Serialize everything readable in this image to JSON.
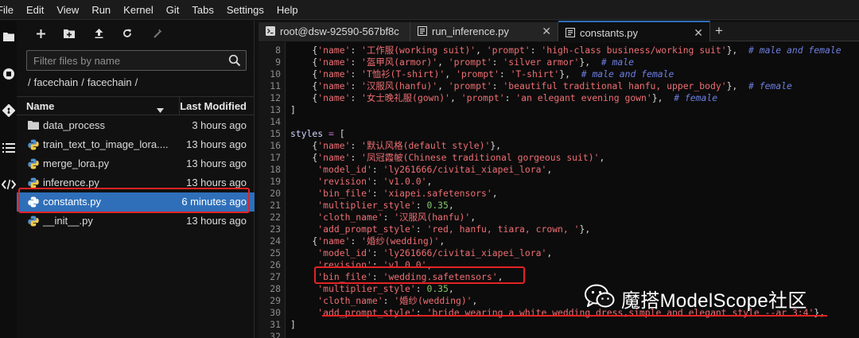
{
  "menu": [
    "File",
    "Edit",
    "View",
    "Run",
    "Kernel",
    "Git",
    "Tabs",
    "Settings",
    "Help"
  ],
  "activity_icons": [
    "folder-icon",
    "running-icon",
    "git-icon",
    "toc-icon",
    "extension-icon"
  ],
  "file_browser": {
    "toolbar_icons": [
      "new-launcher-icon",
      "new-folder-icon",
      "upload-icon",
      "refresh-icon",
      "git-clone-icon"
    ],
    "filter_placeholder": "Filter files by name",
    "breadcrumb": [
      "/",
      "facechain",
      "/",
      "facechain",
      "/"
    ],
    "header_name": "Name",
    "header_modified": "Last Modified",
    "files": [
      {
        "name": "data_process",
        "modified": "3 hours ago",
        "icon": "folder-icon"
      },
      {
        "name": "train_text_to_image_lora....",
        "modified": "13 hours ago",
        "icon": "python-icon"
      },
      {
        "name": "merge_lora.py",
        "modified": "13 hours ago",
        "icon": "python-icon"
      },
      {
        "name": "inference.py",
        "modified": "13 hours ago",
        "icon": "python-icon"
      },
      {
        "name": "constants.py",
        "modified": "6 minutes ago",
        "icon": "python-icon",
        "selected": true
      },
      {
        "name": "__init__.py",
        "modified": "13 hours ago",
        "icon": "python-icon"
      }
    ]
  },
  "tabs": [
    {
      "label": "root@dsw-92590-567bf8c",
      "icon": "terminal-icon"
    },
    {
      "label": "run_inference.py",
      "icon": "file-icon"
    },
    {
      "label": "constants.py",
      "icon": "file-icon",
      "active": true
    }
  ],
  "code_lines": [
    {
      "n": "8",
      "t": [
        [
          "",
          "    {"
        ],
        [
          "s",
          "'name'"
        ],
        [
          "",
          ": "
        ],
        [
          "s",
          "'工作服(working suit)'"
        ],
        [
          "",
          ", "
        ],
        [
          "s",
          "'prompt'"
        ],
        [
          "",
          ": "
        ],
        [
          "s",
          "'high-class business/working suit'"
        ],
        [
          "",
          "},  "
        ],
        [
          "c",
          "# male and female"
        ]
      ]
    },
    {
      "n": "9",
      "t": [
        [
          "",
          "    {"
        ],
        [
          "s",
          "'name'"
        ],
        [
          "",
          ": "
        ],
        [
          "s",
          "'盔甲风(armor)'"
        ],
        [
          "",
          ", "
        ],
        [
          "s",
          "'prompt'"
        ],
        [
          "",
          ": "
        ],
        [
          "s",
          "'silver armor'"
        ],
        [
          "",
          "},  "
        ],
        [
          "c",
          "# male"
        ]
      ]
    },
    {
      "n": "10",
      "t": [
        [
          "",
          "    {"
        ],
        [
          "s",
          "'name'"
        ],
        [
          "",
          ": "
        ],
        [
          "s",
          "'T恤衫(T-shirt)'"
        ],
        [
          "",
          ", "
        ],
        [
          "s",
          "'prompt'"
        ],
        [
          "",
          ": "
        ],
        [
          "s",
          "'T-shirt'"
        ],
        [
          "",
          "},  "
        ],
        [
          "c",
          "# male and female"
        ]
      ]
    },
    {
      "n": "11",
      "t": [
        [
          "",
          "    {"
        ],
        [
          "s",
          "'name'"
        ],
        [
          "",
          ": "
        ],
        [
          "s",
          "'汉服风(hanfu)'"
        ],
        [
          "",
          ", "
        ],
        [
          "s",
          "'prompt'"
        ],
        [
          "",
          ": "
        ],
        [
          "s",
          "'beautiful traditional hanfu, upper_body'"
        ],
        [
          "",
          "},  "
        ],
        [
          "c",
          "# female"
        ]
      ]
    },
    {
      "n": "12",
      "t": [
        [
          "",
          "    {"
        ],
        [
          "s",
          "'name'"
        ],
        [
          "",
          ": "
        ],
        [
          "s",
          "'女士晚礼服(gown)'"
        ],
        [
          "",
          ", "
        ],
        [
          "s",
          "'prompt'"
        ],
        [
          "",
          ": "
        ],
        [
          "s",
          "'an elegant evening gown'"
        ],
        [
          "",
          "},  "
        ],
        [
          "c",
          "# female"
        ]
      ]
    },
    {
      "n": "13",
      "t": [
        [
          "",
          "]"
        ]
      ]
    },
    {
      "n": "14",
      "t": []
    },
    {
      "n": "15",
      "t": [
        [
          "v",
          "styles"
        ],
        [
          "",
          " "
        ],
        [
          "o",
          "="
        ],
        [
          "",
          " ["
        ]
      ]
    },
    {
      "n": "16",
      "t": [
        [
          "",
          "    {"
        ],
        [
          "s",
          "'name'"
        ],
        [
          "",
          ": "
        ],
        [
          "s",
          "'默认风格(default style)'"
        ],
        [
          "",
          "},"
        ]
      ]
    },
    {
      "n": "17",
      "t": [
        [
          "",
          "    {"
        ],
        [
          "s",
          "'name'"
        ],
        [
          "",
          ": "
        ],
        [
          "s",
          "'凤冠霞帔(Chinese traditional gorgeous suit)'"
        ],
        [
          "",
          ","
        ]
      ]
    },
    {
      "n": "18",
      "t": [
        [
          "",
          "     "
        ],
        [
          "s",
          "'model_id'"
        ],
        [
          "",
          ": "
        ],
        [
          "s",
          "'ly261666/civitai_xiapei_lora'"
        ],
        [
          "",
          ","
        ]
      ]
    },
    {
      "n": "19",
      "t": [
        [
          "",
          "     "
        ],
        [
          "s",
          "'revision'"
        ],
        [
          "",
          ": "
        ],
        [
          "s",
          "'v1.0.0'"
        ],
        [
          "",
          ","
        ]
      ]
    },
    {
      "n": "20",
      "t": [
        [
          "",
          "     "
        ],
        [
          "s",
          "'bin_file'"
        ],
        [
          "",
          ": "
        ],
        [
          "s",
          "'xiapei.safetensors'"
        ],
        [
          "",
          ","
        ]
      ]
    },
    {
      "n": "21",
      "t": [
        [
          "",
          "     "
        ],
        [
          "s",
          "'multiplier_style'"
        ],
        [
          "",
          ": "
        ],
        [
          "n",
          "0.35"
        ],
        [
          "",
          ","
        ]
      ]
    },
    {
      "n": "22",
      "t": [
        [
          "",
          "     "
        ],
        [
          "s",
          "'cloth_name'"
        ],
        [
          "",
          ": "
        ],
        [
          "s",
          "'汉服风(hanfu)'"
        ],
        [
          "",
          ","
        ]
      ]
    },
    {
      "n": "23",
      "t": [
        [
          "",
          "     "
        ],
        [
          "s",
          "'add_prompt_style'"
        ],
        [
          "",
          ": "
        ],
        [
          "s",
          "'red, hanfu, tiara, crown, '"
        ],
        [
          "",
          "},"
        ]
      ]
    },
    {
      "n": "24",
      "t": [
        [
          "",
          "    {"
        ],
        [
          "s",
          "'name'"
        ],
        [
          "",
          ": "
        ],
        [
          "s",
          "'婚纱(wedding)'"
        ],
        [
          "",
          ","
        ]
      ]
    },
    {
      "n": "25",
      "t": [
        [
          "",
          "     "
        ],
        [
          "s",
          "'model_id'"
        ],
        [
          "",
          ": "
        ],
        [
          "s",
          "'ly261666/civitai_xiapei_lora'"
        ],
        [
          "",
          ","
        ]
      ]
    },
    {
      "n": "26",
      "t": [
        [
          "",
          "     "
        ],
        [
          "s",
          "'revision'"
        ],
        [
          "",
          ": "
        ],
        [
          "s",
          "'v1.0.0'"
        ],
        [
          "",
          ","
        ]
      ]
    },
    {
      "n": "27",
      "t": [
        [
          "",
          "     "
        ],
        [
          "s",
          "'bin_file'"
        ],
        [
          "",
          ": "
        ],
        [
          "s",
          "'wedding.safetensors'"
        ],
        [
          "",
          ","
        ]
      ]
    },
    {
      "n": "28",
      "t": [
        [
          "",
          "     "
        ],
        [
          "s",
          "'multiplier_style'"
        ],
        [
          "",
          ": "
        ],
        [
          "n",
          "0.35"
        ],
        [
          "",
          ","
        ]
      ]
    },
    {
      "n": "29",
      "t": [
        [
          "",
          "     "
        ],
        [
          "s",
          "'cloth_name'"
        ],
        [
          "",
          ": "
        ],
        [
          "s",
          "'婚纱(wedding)'"
        ],
        [
          "",
          ","
        ]
      ]
    },
    {
      "n": "30",
      "t": [
        [
          "",
          "     "
        ],
        [
          "s",
          "'add_prompt_style'"
        ],
        [
          "",
          ": "
        ],
        [
          "s",
          "'bride wearing a white wedding dress,simple and elegant style --ar 3:4'"
        ],
        [
          "",
          "},"
        ]
      ]
    },
    {
      "n": "31",
      "t": [
        [
          "",
          "]"
        ]
      ]
    },
    {
      "n": "32",
      "t": []
    }
  ],
  "watermark": "魔搭ModelScope社区",
  "colors": {
    "selection": "#2f6fb9",
    "highlight_box": "#e32323",
    "string": "#ee6e73",
    "number": "#86c56e",
    "comment": "#6e7fe0"
  }
}
